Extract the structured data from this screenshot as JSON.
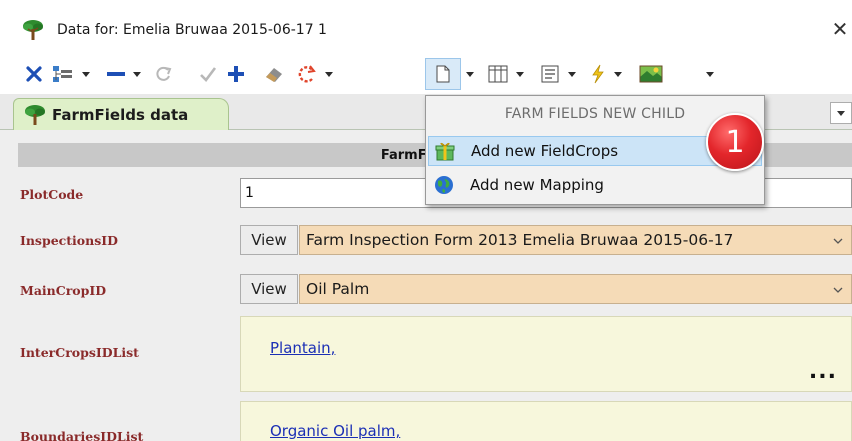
{
  "window": {
    "title": "Data for:  Emelia Bruwaa 2015-06-17 1",
    "close_glyph": "✕",
    "icon": "tree-icon"
  },
  "toolbar": {
    "icons": [
      "close-icon",
      "tree-view-icon",
      "minus-icon",
      "refresh-icon",
      "check-icon",
      "plus-icon",
      "eraser-icon",
      "undo-icon",
      "new-document-icon",
      "grid-icon",
      "list-icon",
      "lightning-icon",
      "map-image-icon"
    ]
  },
  "tabs": {
    "active_label": "FarmFields data"
  },
  "form": {
    "section_header": "FarmFields: da",
    "fields": {
      "plot_code": {
        "label": "PlotCode",
        "value": "1"
      },
      "inspections": {
        "label": "InspectionsID",
        "view_label": "View",
        "value": "Farm Inspection Form 2013 Emelia Bruwaa 2015-06-17"
      },
      "main_crop": {
        "label": "MainCropID",
        "view_label": "View",
        "value": "Oil Palm"
      },
      "intercrops": {
        "label": "InterCropsIDList",
        "value": "Plantain,",
        "more": "..."
      },
      "boundaries": {
        "label": "BoundariesIDList",
        "value": "Organic Oil palm,"
      }
    }
  },
  "menu": {
    "header": "FARM FIELDS  NEW CHILD",
    "items": [
      {
        "label": "Add new FieldCrops",
        "icon": "gift-icon",
        "highlighted": true
      },
      {
        "label": "Add new Mapping",
        "icon": "globe-icon",
        "highlighted": false
      }
    ]
  },
  "callout": {
    "number": "1",
    "color": "#e3262b"
  }
}
